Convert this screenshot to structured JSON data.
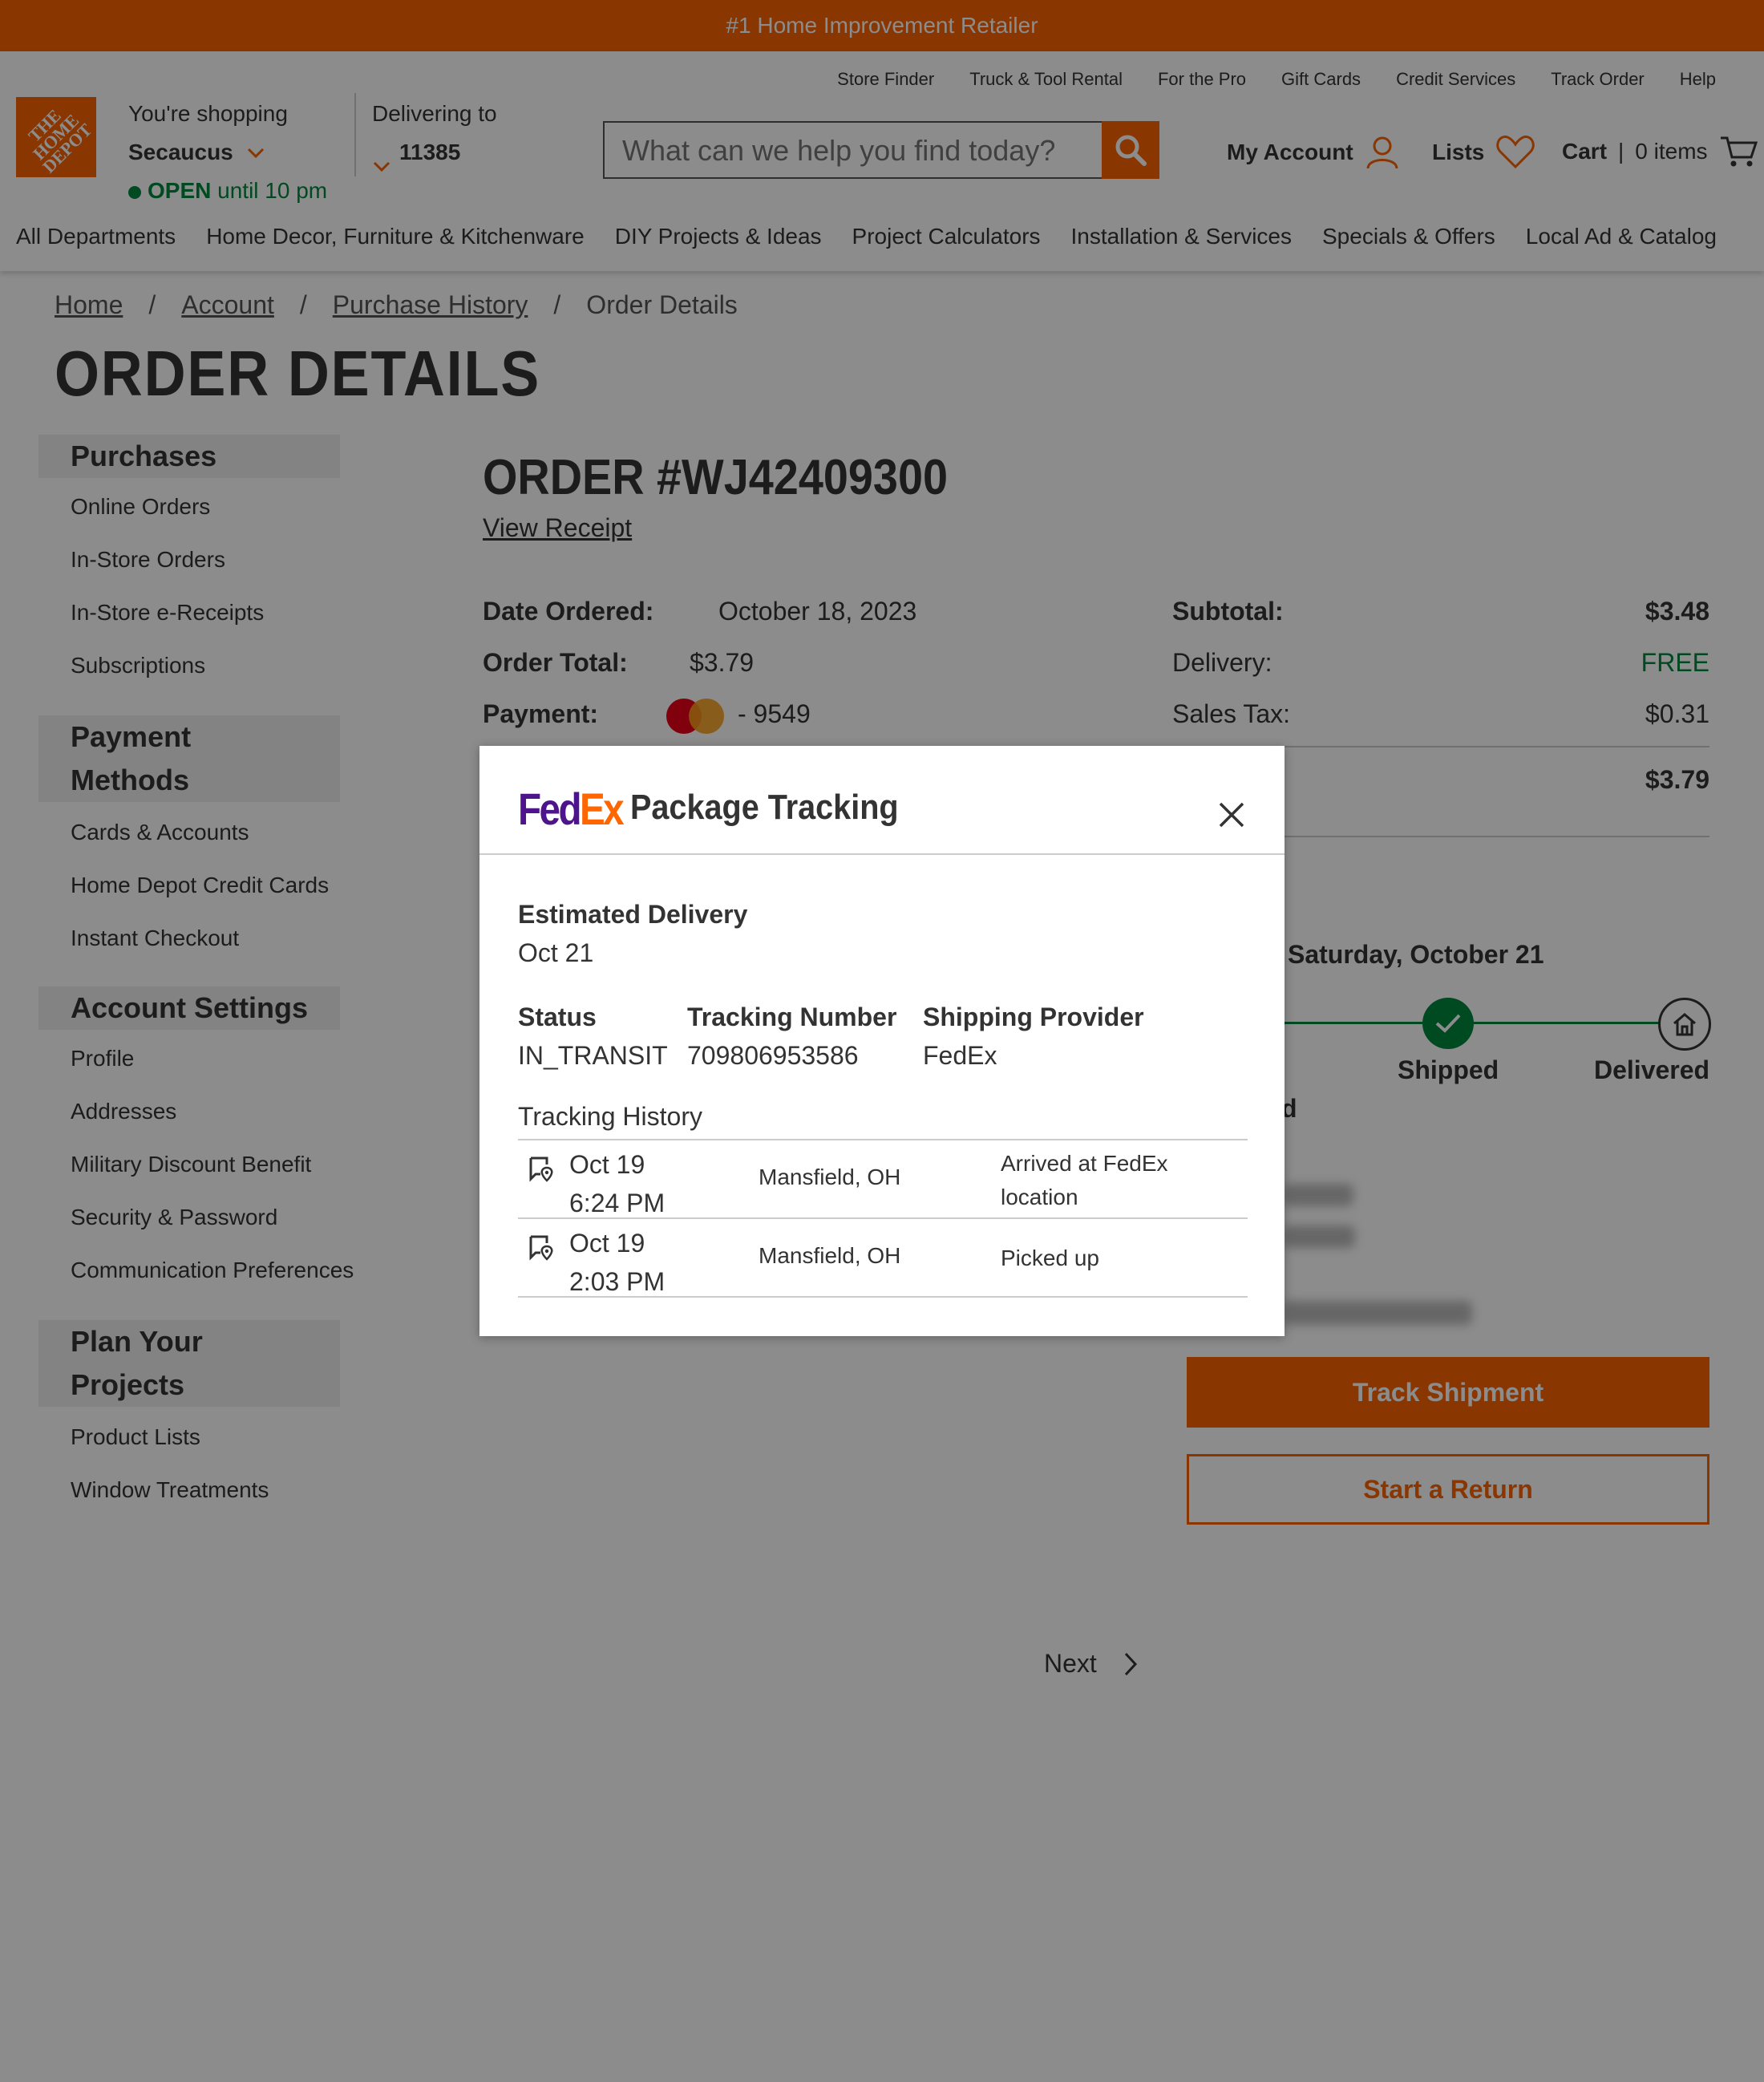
{
  "banner": {
    "text": "#1 Home Improvement Retailer"
  },
  "header": {
    "util_links": [
      "Store Finder",
      "Truck & Tool Rental",
      "For the Pro",
      "Gift Cards",
      "Credit Services",
      "Track Order",
      "Help"
    ],
    "logo_text": "THE HOME DEPOT",
    "store": {
      "shopping_label": "You're shopping",
      "name": "Secaucus",
      "open_label": "OPEN",
      "hours": "until 10 pm"
    },
    "delivery": {
      "label": "Delivering to",
      "zip": "11385"
    },
    "search": {
      "placeholder": "What can we help you find today?"
    },
    "account_label": "My Account",
    "lists_label": "Lists",
    "cart_label": "Cart",
    "cart_items": "0 items",
    "nav": [
      "All Departments",
      "Home Decor, Furniture & Kitchenware",
      "DIY Projects & Ideas",
      "Project Calculators",
      "Installation & Services",
      "Specials & Offers",
      "Local Ad & Catalog"
    ]
  },
  "breadcrumb": [
    "Home",
    "Account",
    "Purchase History",
    "Order Details"
  ],
  "page_title": "ORDER DETAILS",
  "sidebar": {
    "sections": [
      {
        "title": "Purchases",
        "items": [
          "Online Orders",
          "In-Store Orders",
          "In-Store e-Receipts",
          "Subscriptions"
        ]
      },
      {
        "title": "Payment Methods",
        "items": [
          "Cards & Accounts",
          "Home Depot Credit Cards",
          "Instant Checkout"
        ]
      },
      {
        "title": "Account Settings",
        "items": [
          "Profile",
          "Addresses",
          "Military Discount Benefit",
          "Security & Password",
          "Communication Preferences"
        ]
      },
      {
        "title": "Plan Your Projects",
        "items": [
          "Product Lists",
          "Window Treatments"
        ]
      }
    ]
  },
  "order": {
    "title": "ORDER #WJ42409300",
    "view_receipt": "View Receipt",
    "date_label": "Date Ordered:",
    "date": "October 18, 2023",
    "total_label": "Order Total:",
    "total": "$3.79",
    "payment_label": "Payment:",
    "card_suffix": "- 9549",
    "subtotal_label": "Subtotal:",
    "subtotal": "$3.48",
    "delivery_label": "Delivery:",
    "delivery": "FREE",
    "tax_label": "Sales Tax:",
    "tax": "$0.31",
    "grand_total": "$3.79",
    "delivery_date": "Saturday, October 21",
    "steps": [
      "Shipped",
      "Delivered"
    ],
    "partial_label": "d",
    "track_button": "Track Shipment",
    "return_button": "Start a Return"
  },
  "pagination": {
    "next_label": "Next"
  },
  "modal": {
    "title": "Package Tracking",
    "carrier_logo": {
      "fd": "Fed",
      "ex": "Ex"
    },
    "est_label": "Estimated Delivery",
    "est_value": "Oct 21",
    "status_label": "Status",
    "status_value": "IN_TRANSIT",
    "tracking_label": "Tracking Number",
    "tracking_value": "709806953586",
    "provider_label": "Shipping Provider",
    "provider_value": "FedEx",
    "history_label": "Tracking History",
    "history": [
      {
        "date": "Oct 19",
        "time": "6:24 PM",
        "location": "Mansfield, OH",
        "description": "Arrived at FedEx location"
      },
      {
        "date": "Oct 19",
        "time": "2:03 PM",
        "location": "Mansfield, OH",
        "description": "Picked up"
      }
    ]
  },
  "colors": {
    "brand_orange": "#f96302",
    "success_green": "#00873c",
    "fedex_purple": "#4d148c",
    "fedex_orange": "#ff6600"
  }
}
